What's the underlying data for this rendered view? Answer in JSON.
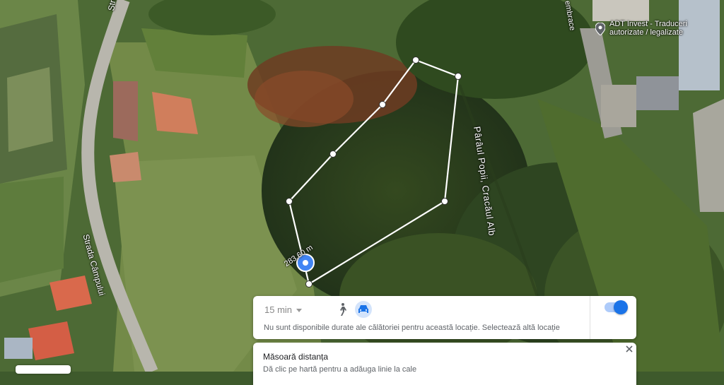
{
  "map": {
    "street_top": "Strada C",
    "street_bottom": "Strada Câmpului",
    "stream": "Pârâul Popii, Cracăul Alb",
    "place_embrace": "embrace",
    "poi": {
      "name": "ADT Invest - Traduceri autorizate / legalizate",
      "icon": "pin-icon"
    },
    "distance_label": "283,60 m"
  },
  "directions_panel": {
    "time_value": "15 min",
    "modes": [
      "walk-icon",
      "car-icon"
    ],
    "selected_mode": "car",
    "toggle_on": true,
    "message": "Nu sunt disponibile durate ale călătoriei pentru această locație. Selectează altă locație"
  },
  "measure_panel": {
    "title": "Măsoară distanța",
    "hint": "Dă clic pe hartă pentru a adăuga linie la cale",
    "close_icon": "close-icon"
  },
  "colors": {
    "accent": "#1a73e8",
    "measure_line": "#ffffff"
  }
}
